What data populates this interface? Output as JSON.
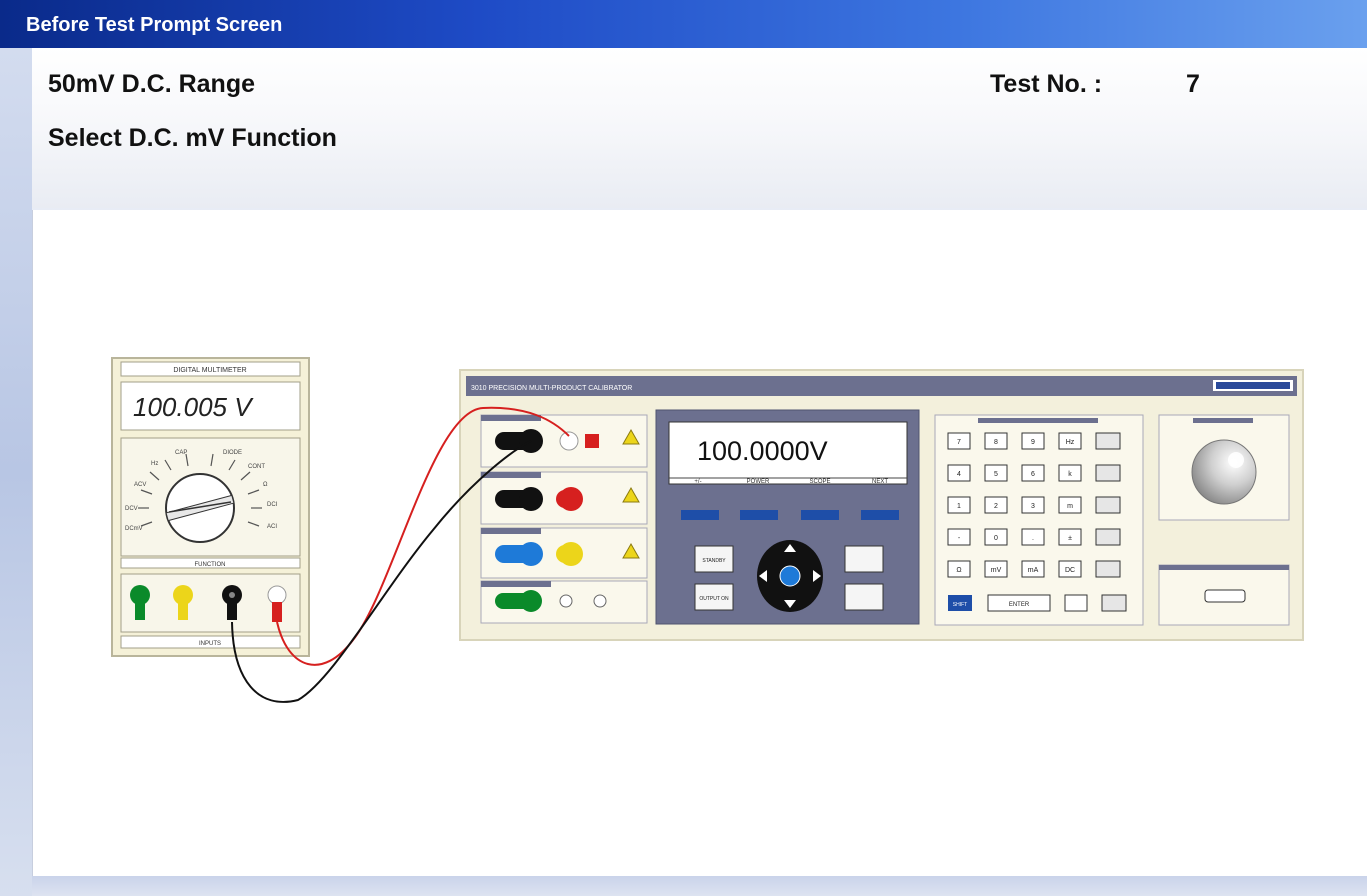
{
  "window": {
    "title": "Before Test Prompt Screen"
  },
  "header": {
    "range": "50mV D.C. Range",
    "test_no_label": "Test No. :",
    "test_no_value": "7",
    "instruction": "Select D.C. mV Function"
  },
  "multimeter": {
    "title": "DIGITAL MULTIMETER",
    "display": "100.005 V",
    "function_label": "FUNCTION",
    "inputs_label": "INPUTS"
  },
  "calibrator": {
    "title": "3010 PRECISION MULTI-PRODUCT CALIBRATOR",
    "display_value": "100.0000V",
    "softkeys": [
      "+/-",
      "POWER",
      "SCOPE",
      "NEXT"
    ],
    "keypad": [
      [
        "7",
        "8",
        "9",
        "Hz"
      ],
      [
        "4",
        "5",
        "6",
        "k"
      ],
      [
        "1",
        "2",
        "3",
        "m"
      ],
      [
        "-",
        "0",
        ".",
        "±"
      ],
      [
        "Ω",
        "mV",
        "mA",
        "DC"
      ]
    ],
    "enter_label": "ENTER",
    "shift_label": "SHIFT",
    "standby_label": "STANDBY",
    "output_on_label": "OUTPUT ON",
    "colors": {
      "panel": "#f3f0dc",
      "display_frame": "#6c708f",
      "key_blue": "#1e4ea8"
    }
  }
}
